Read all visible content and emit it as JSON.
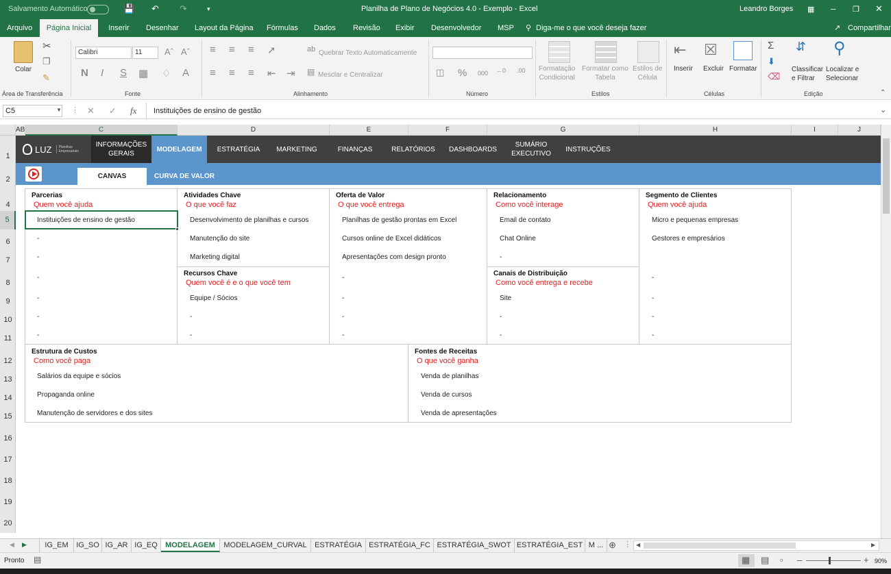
{
  "titlebar": {
    "autosave_label": "Salvamento Automático",
    "title": "Planilha de Plano de Negócios 4.0 - Exemplo  -  Excel",
    "user": "Leandro Borges"
  },
  "ribbon_tabs": [
    "Arquivo",
    "Página Inicial",
    "Inserir",
    "Desenhar",
    "Layout da Página",
    "Fórmulas",
    "Dados",
    "Revisão",
    "Exibir",
    "Desenvolvedor",
    "MSP"
  ],
  "tell_me": "Diga-me o que você deseja fazer",
  "share": "Compartilhar",
  "ribbon": {
    "paste": "Colar",
    "font_name": "Calibri",
    "font_size": "11",
    "bold": "N",
    "italic": "I",
    "underline": "S",
    "wrap_text": "Quebrar Texto Automaticamente",
    "merge_center": "Mesclar e Centralizar",
    "conditional_format": "Formatação\nCondicional",
    "format_table": "Formatar como\nTabela",
    "cell_styles": "Estilos de\nCélula",
    "insert": "Inserir",
    "delete": "Excluir",
    "format": "Formatar",
    "sort_filter": "Classificar\ne Filtrar",
    "find_select": "Localizar e\nSelecionar",
    "groups": {
      "clipboard": "Área de Transferência",
      "font": "Fonte",
      "alignment": "Alinhamento",
      "number": "Número",
      "styles": "Estilos",
      "cells": "Células",
      "editing": "Edição"
    }
  },
  "formula_bar": {
    "name_box": "C5",
    "fx": "fx",
    "content": "Instituições de ensino de gestão"
  },
  "columns": [
    "AB",
    "C",
    "D",
    "E",
    "F",
    "G",
    "H",
    "I",
    "J"
  ],
  "rows": [
    "1",
    "2",
    "4",
    "5",
    "6",
    "7",
    "8",
    "9",
    "10",
    "11",
    "12",
    "13",
    "14",
    "15",
    "16",
    "17",
    "18",
    "19",
    "20"
  ],
  "nav": {
    "logo": "LUZ",
    "logo_sub": "Planilhas\nEmpresariais",
    "items": [
      "INFORMAÇÕES\nGERAIS",
      "MODELAGEM",
      "ESTRATÉGIA",
      "MARKETING",
      "FINANÇAS",
      "RELATÓRIOS",
      "DASHBOARDS",
      "SUMÁRIO\nEXECUTIVO",
      "INSTRUÇÕES"
    ],
    "sub": [
      "CANVAS",
      "CURVA DE VALOR"
    ]
  },
  "canvas": {
    "parcerias": {
      "title": "Parcerias",
      "subtitle": "Quem você ajuda",
      "items": [
        "Instituições de ensino de gestão",
        "-",
        "-",
        "-",
        "-",
        "-",
        "-"
      ]
    },
    "atividades": {
      "title": "Atividades Chave",
      "subtitle": "O que você faz",
      "items": [
        "Desenvolvimento de planilhas e cursos",
        "Manutenção do site",
        "Marketing digital"
      ]
    },
    "recursos": {
      "title": "Recursos Chave",
      "subtitle": "Quem você é e o que você tem",
      "items": [
        "Equipe / Sócios",
        "-",
        "-"
      ]
    },
    "oferta": {
      "title": "Oferta de Valor",
      "subtitle": "O que você entrega",
      "items": [
        "Planilhas de gestão prontas em Excel",
        "Cursos online de Excel didáticos",
        "Apresentações com design pronto",
        "-",
        "-",
        "-",
        "-"
      ]
    },
    "relacionamento": {
      "title": "Relacionamento",
      "subtitle": "Como você interage",
      "items": [
        "Email de contato",
        "Chat Online",
        "-"
      ]
    },
    "canais": {
      "title": "Canais de Distribuição",
      "subtitle": "Como você entrega e recebe",
      "items": [
        "Site",
        "-",
        "-"
      ]
    },
    "segmento": {
      "title": "Segmento de Clientes",
      "subtitle": "Quem você ajuda",
      "items": [
        "Micro e pequenas empresas",
        "Gestores e empresários",
        "-",
        "-",
        "-",
        "-"
      ]
    },
    "custos": {
      "title": "Estrutura de Custos",
      "subtitle": "Como você paga",
      "items": [
        "Salários da equipe e sócios",
        "Propaganda online",
        "Manutenção de servidores e dos sites"
      ]
    },
    "receitas": {
      "title": "Fontes de Receitas",
      "subtitle": "O que você ganha",
      "items": [
        "Venda de planilhas",
        "Venda de cursos",
        "Venda de apresentações"
      ]
    }
  },
  "sheet_tabs": [
    "IG_EM",
    "IG_SO",
    "IG_AR",
    "IG_EQ",
    "MODELAGEM",
    "MODELAGEM_CURVAL",
    "ESTRATÉGIA",
    "ESTRATÉGIA_FC",
    "ESTRATÉGIA_SWOT",
    "ESTRATÉGIA_EST",
    "M ..."
  ],
  "status": {
    "ready": "Pronto",
    "zoom": "90%"
  },
  "colors": {
    "excel_green": "#217346",
    "nav_dark": "#404040",
    "nav_active": "#5b95cc",
    "subtitle_red": "#e02020"
  }
}
